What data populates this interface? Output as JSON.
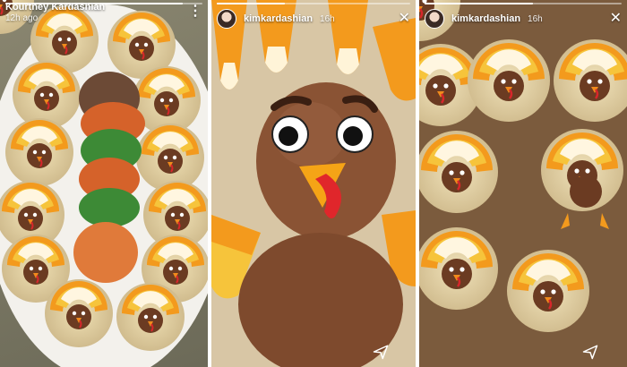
{
  "stories": [
    {
      "username": "Kourtney Kardashian",
      "time": "12h ago",
      "progress": 0.9
    },
    {
      "username": "kimkardashian",
      "time": "16h",
      "progress": 0.35
    },
    {
      "username": "kimkardashian",
      "time": "16h",
      "progress": 0.55
    }
  ],
  "icons": {
    "more": "more-vertical-icon",
    "close": "close-icon",
    "send": "send-icon"
  },
  "colors": {
    "candy_orange": "#f39a1d",
    "candy_yellow": "#f6c43b",
    "chocolate": "#6b3b22",
    "rice_krispie": "#e6d6a8"
  }
}
